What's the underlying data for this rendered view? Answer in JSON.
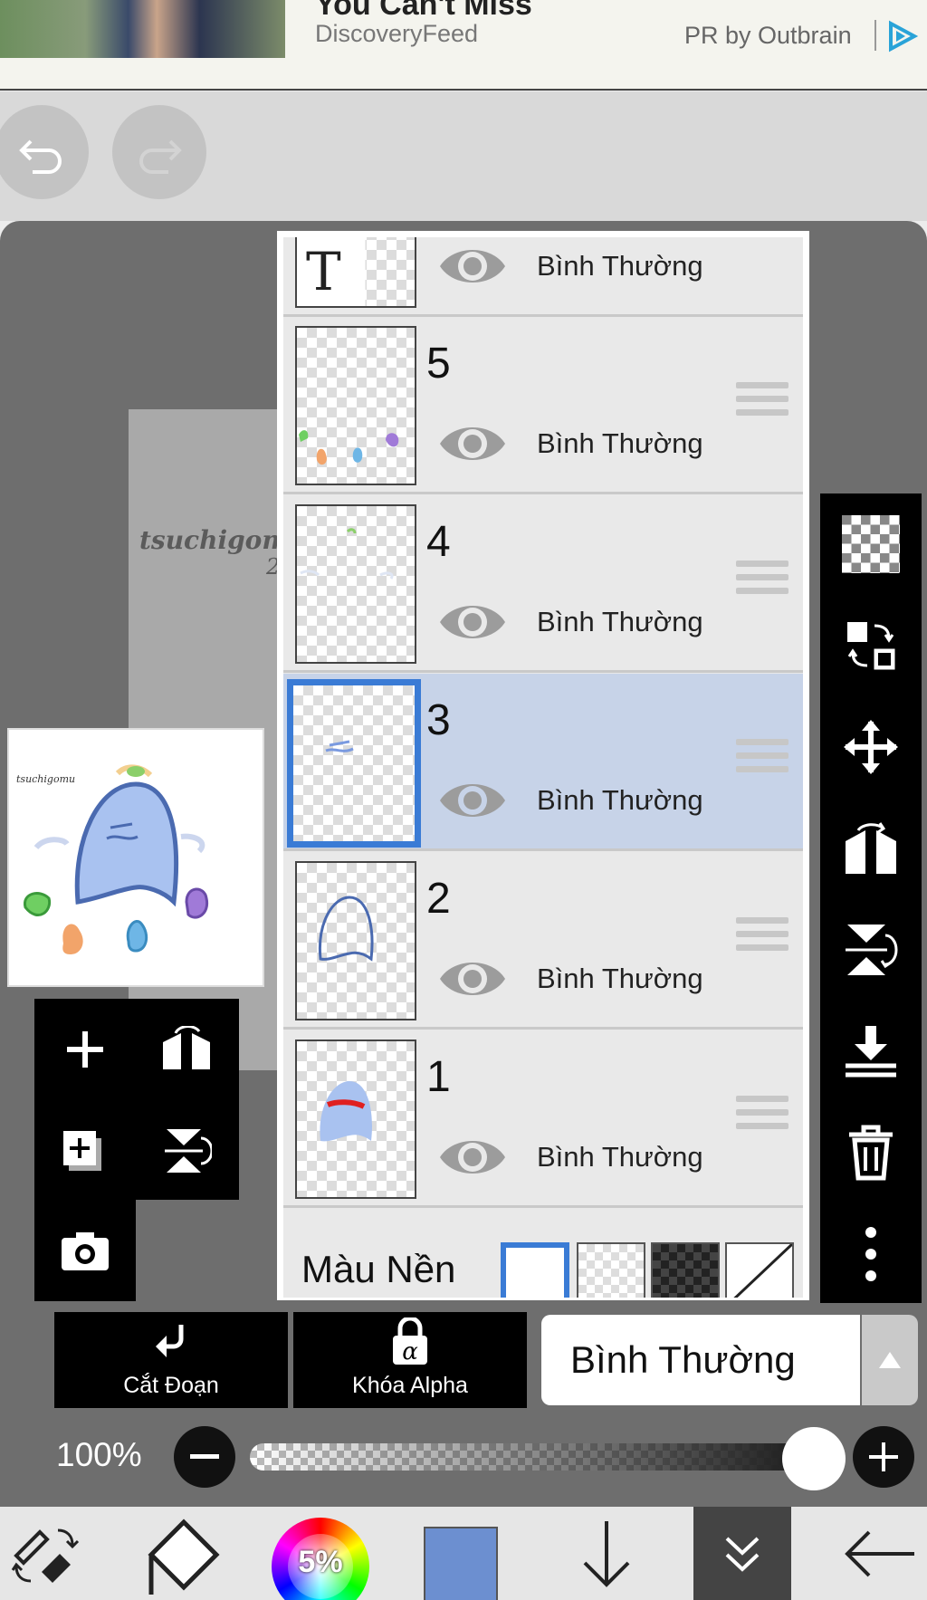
{
  "ad": {
    "title": "You Can't Miss",
    "source": "DiscoveryFeed",
    "sponsor": "PR by Outbrain"
  },
  "canvas": {
    "watermark_line1": "tsuchigomu",
    "watermark_line2": "2"
  },
  "layers": [
    {
      "name": "",
      "blend": "Bình Thường",
      "type": "text",
      "thumb_label": "T"
    },
    {
      "name": "5",
      "blend": "Bình Thường"
    },
    {
      "name": "4",
      "blend": "Bình Thường"
    },
    {
      "name": "3",
      "blend": "Bình Thường",
      "selected": true
    },
    {
      "name": "2",
      "blend": "Bình Thường"
    },
    {
      "name": "1",
      "blend": "Bình Thường"
    }
  ],
  "background": {
    "label": "Màu Nền",
    "selected": "white"
  },
  "layer_controls": {
    "clip_label": "Cắt Đoạn",
    "alpha_label": "Khóa Alpha",
    "blend_mode": "Bình Thường"
  },
  "opacity": {
    "label": "100%",
    "value": 1.0
  },
  "bottom_bar": {
    "brush_size_label": "5%",
    "current_color": "#6c8fd0"
  },
  "colors": {
    "selection_blue": "#3a7bd5",
    "selected_row": "#c7d3e8",
    "panel_bg": "#e9e9e9"
  },
  "icons": {
    "undo": "undo-icon",
    "redo": "redo-icon",
    "eye": "eye-icon",
    "checker": "transparency-icon",
    "move": "move-icon",
    "flip-h": "flip-horizontal-icon",
    "flip-v": "flip-vertical-icon",
    "merge": "merge-down-icon",
    "trash": "trash-icon",
    "more": "more-vertical-icon"
  }
}
